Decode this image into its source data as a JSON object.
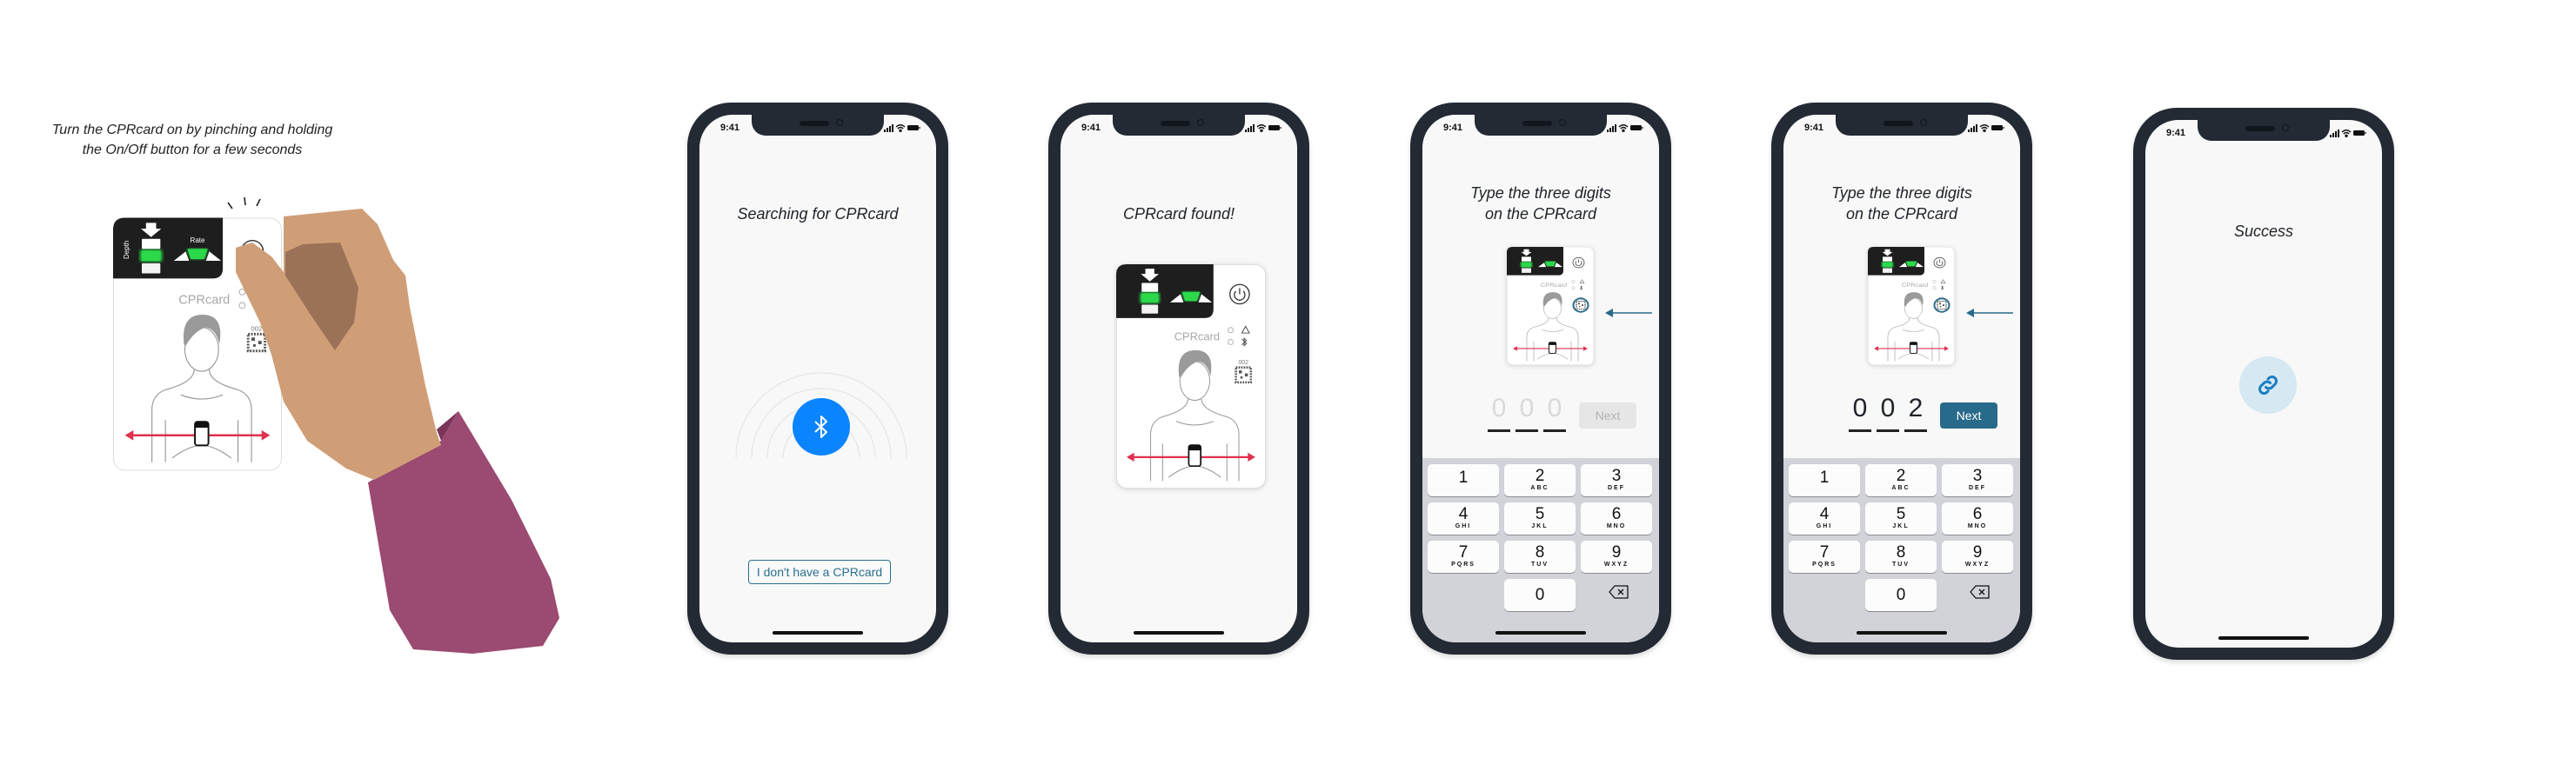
{
  "instruction": {
    "line1": "Turn the CPRcard on by pinching and holding",
    "line2": "the On/Off button for a few seconds"
  },
  "card_illustration": {
    "depth_label": "Depth",
    "rate_label": "Rate",
    "logo": "CPRcard",
    "serial": "002"
  },
  "status_bar": {
    "time": "9:41"
  },
  "colors": {
    "phone_frame": "#232a33",
    "bluetooth_blue": "#0a84ff",
    "primary_teal": "#276a8a",
    "arrow_red": "#e0304e",
    "indicator_green": "#2bd94a",
    "sleeve": "#9b4a72",
    "skin": "#cf9e77"
  },
  "screens": [
    {
      "title": "Searching for CPRcard",
      "icon": "bluetooth-icon",
      "secondary_button": "I don't have a CPRcard"
    },
    {
      "title": "CPRcard found!"
    },
    {
      "title_line1": "Type the three digits",
      "title_line2": "on the CPRcard",
      "digits": [
        "0",
        "0",
        "0"
      ],
      "digits_are_placeholder": true,
      "next_label": "Next",
      "next_enabled": false
    },
    {
      "title_line1": "Type the three digits",
      "title_line2": "on the CPRcard",
      "digits": [
        "0",
        "0",
        "2"
      ],
      "digits_are_placeholder": false,
      "next_label": "Next",
      "next_enabled": true
    },
    {
      "title": "Success",
      "icon": "link-icon"
    }
  ],
  "keypad": {
    "keys": [
      {
        "num": "1",
        "letters": ""
      },
      {
        "num": "2",
        "letters": "ABC"
      },
      {
        "num": "3",
        "letters": "DEF"
      },
      {
        "num": "4",
        "letters": "GHI"
      },
      {
        "num": "5",
        "letters": "JKL"
      },
      {
        "num": "6",
        "letters": "MNO"
      },
      {
        "num": "7",
        "letters": "PQRS"
      },
      {
        "num": "8",
        "letters": "TUV"
      },
      {
        "num": "9",
        "letters": "WXYZ"
      },
      {
        "num": "0",
        "letters": ""
      }
    ],
    "delete_icon": "backspace-icon"
  }
}
